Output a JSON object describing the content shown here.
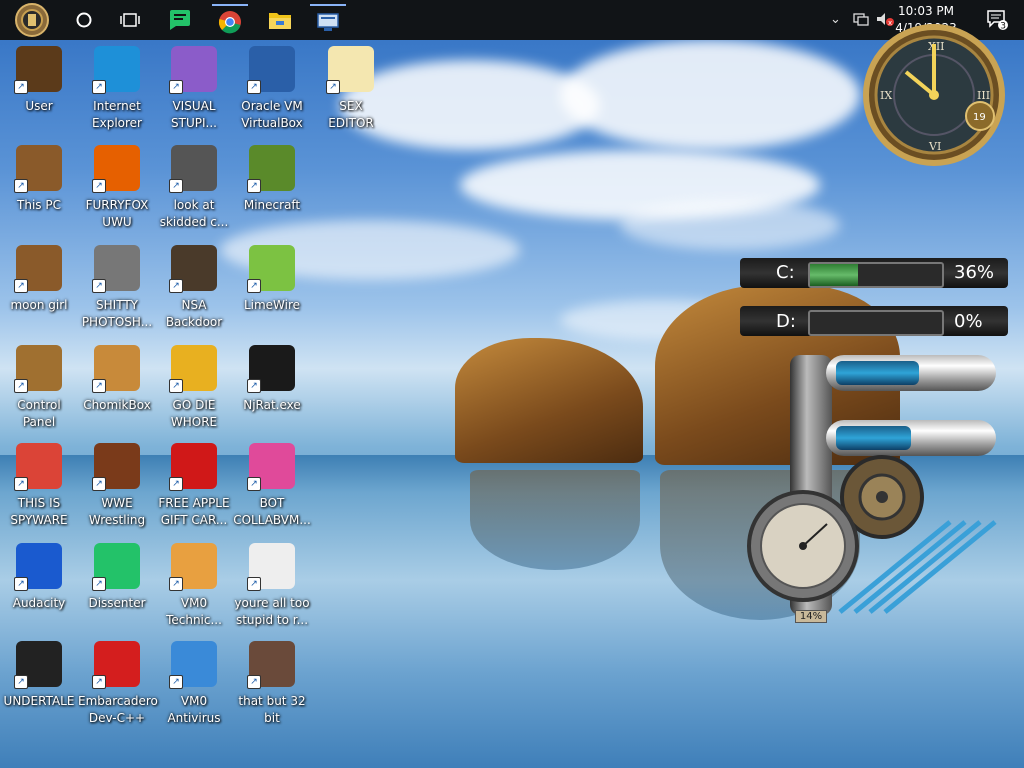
{
  "taskbar": {
    "time": "10:03 PM",
    "date": "4/19/2023",
    "notification_count": "3",
    "pinned": [
      "start-button",
      "search-circle",
      "task-view",
      "dissenter",
      "chrome",
      "file-explorer",
      "network-app"
    ]
  },
  "desktop_icons": [
    {
      "label": "User",
      "icon": "user-folder-icon"
    },
    {
      "label": "Internet\nExplorer",
      "icon": "edge-icon"
    },
    {
      "label": "VISUAL\nSTUPI...",
      "icon": "visual-studio-icon"
    },
    {
      "label": "Oracle VM\nVirtualBox",
      "icon": "virtualbox-icon"
    },
    {
      "label": "SEX\nEDITOR",
      "icon": "hxd-editor-icon"
    },
    {
      "label": "This PC",
      "icon": "computer-icon"
    },
    {
      "label": "FURRYFOX\nUWU",
      "icon": "firefox-icon"
    },
    {
      "label": "look at\nskidded c...",
      "icon": "stacked-windows-icon"
    },
    {
      "label": "Minecraft",
      "icon": "grass-block-icon"
    },
    {
      "label": "moon girl",
      "icon": "wooden-box-icon"
    },
    {
      "label": "SHITTY\nPHOTOSH...",
      "icon": "gimp-icon"
    },
    {
      "label": "NSA\nBackdoor",
      "icon": "safe-icon"
    },
    {
      "label": "LimeWire",
      "icon": "limewire-icon"
    },
    {
      "label": "Control Panel",
      "icon": "lamp-icon"
    },
    {
      "label": "ChomikBox",
      "icon": "hamster-box-icon"
    },
    {
      "label": "GO DIE\nWHORE",
      "icon": "dreamweaver-icon"
    },
    {
      "label": "NjRat.exe",
      "icon": "skull-icon"
    },
    {
      "label": "THIS IS\nSPYWARE",
      "icon": "chrome-icon"
    },
    {
      "label": "WWE\nWrestling",
      "icon": "oven-icon"
    },
    {
      "label": "FREE APPLE\nGIFT CAR...",
      "icon": "apple-icon"
    },
    {
      "label": "BOT\nCOLLABVM...",
      "icon": "pink-monitor-icon"
    },
    {
      "label": "Audacity",
      "icon": "audacity-icon"
    },
    {
      "label": "Dissenter",
      "icon": "dissenter-icon"
    },
    {
      "label": "VM0\nTechnic...",
      "icon": "technician-icon"
    },
    {
      "label": "youre all too\nstupid to r...",
      "icon": "portrait-sketch-icon"
    },
    {
      "label": "UNDERTALE",
      "icon": "unity-icon"
    },
    {
      "label": "Embarcadero\nDev-C++",
      "icon": "devcpp-icon"
    },
    {
      "label": "VM0\nAntivirus",
      "icon": "shield-icon"
    },
    {
      "label": "that but 32\nbit",
      "icon": "portrait-painting-icon"
    }
  ],
  "clock_widget": {
    "day": "19"
  },
  "drives": [
    {
      "letter": "C:",
      "percent": "36%",
      "fill": 0.36
    },
    {
      "letter": "D:",
      "percent": "0%",
      "fill": 0.0
    }
  ],
  "gauges": {
    "tube_top_fill": 0.55,
    "tube_bottom_fill": 0.5,
    "gauge_label": "14%"
  },
  "colors": {
    "taskbar": "#111417",
    "drive_fill": "#4caf50",
    "tube_fill": "#2fa4d8"
  }
}
